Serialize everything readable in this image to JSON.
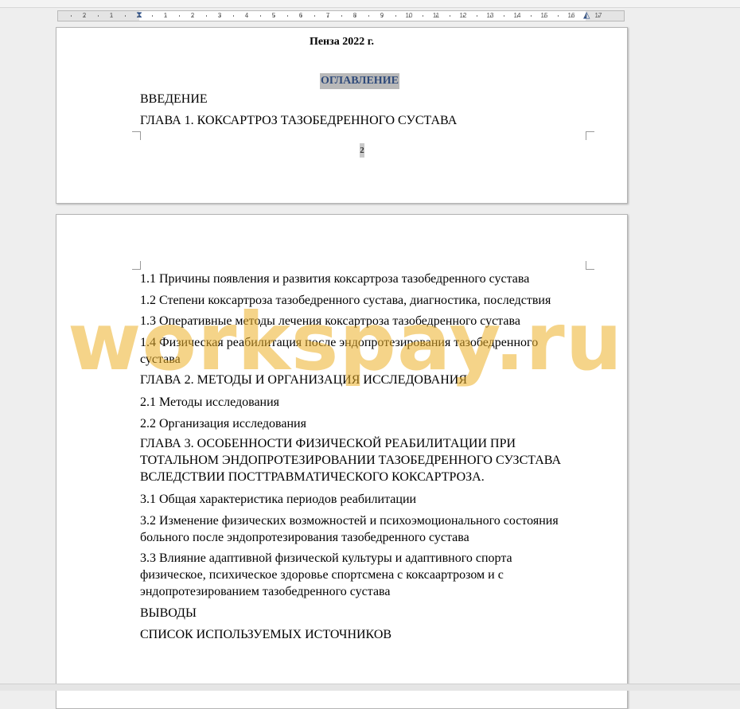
{
  "ruler": {
    "labels": [
      "2",
      "1",
      "1",
      "2",
      "3",
      "4",
      "5",
      "6",
      "7",
      "8",
      "9",
      "10",
      "11",
      "12",
      "13",
      "14",
      "15",
      "16",
      "17"
    ]
  },
  "page1": {
    "city_year": "Пенза 2022 г.",
    "toc_title": "ОГЛАВЛЕНИЕ",
    "toc_items": [
      "ВВЕДЕНИЕ",
      "ГЛАВА 1. КОКСАРТРОЗ ТАЗОБЕДРЕННОГО СУСТАВА"
    ],
    "page_number": "2"
  },
  "page2": {
    "items": [
      {
        "lines": [
          "1.1 Причины появления и развития коксартроза тазобедренного сустава"
        ]
      },
      {
        "lines": [
          "1.2 Степени коксартроза тазобедренного сустава, диагностика,  последствия"
        ]
      },
      {
        "lines": [
          "1.3 Оперативные методы лечения коксартроза тазобедренного сустава"
        ]
      },
      {
        "lines": [
          "1.4 Физическая реабилитация после эндопротезирования тазобедренного",
          "сустава"
        ]
      },
      {
        "lines": [
          "ГЛАВА 2. МЕТОДЫ И ОРГАНИЗАЦИЯ ИССЛЕДОВАНИЯ"
        ]
      },
      {
        "lines": [
          "2.1 Методы исследования"
        ]
      },
      {
        "lines": [
          "2.2 Организация исследования"
        ]
      },
      {
        "lines": [
          "ГЛАВА 3. ОСОБЕННОСТИ ФИЗИЧЕСКОЙ РЕАБИЛИТАЦИИ ПРИ",
          "ТОТАЛЬНОМ ЭНДОПРОТЕЗИРОВАНИИ ТАЗОБЕДРЕННОГО СУЗСТАВА",
          "ВСЛЕДСТВИИ ПОСТТРАВМАТИЧЕСКОГО КОКСАРТРОЗА."
        ]
      },
      {
        "lines": [
          "3.1 Общая характеристика периодов реабилитации"
        ]
      },
      {
        "lines": [
          "3.2 Изменение физических возможностей и психоэмоционального состояния",
          "больного после эндопротезирования тазобедренного сустава"
        ]
      },
      {
        "lines": [
          "3.3 Влияние адаптивной физической культуры и адаптивного спорта",
          "физическое, психическое здоровье спортсмена с коксаартрозом и с",
          "эндопротезированием тазобедренного сустава"
        ]
      },
      {
        "lines": [
          "ВЫВОДЫ"
        ]
      },
      {
        "lines": [
          "СПИСОК ИСПОЛЬЗУЕМЫХ ИСТОЧНИКОВ"
        ]
      }
    ]
  },
  "watermark": "workspay.ru"
}
